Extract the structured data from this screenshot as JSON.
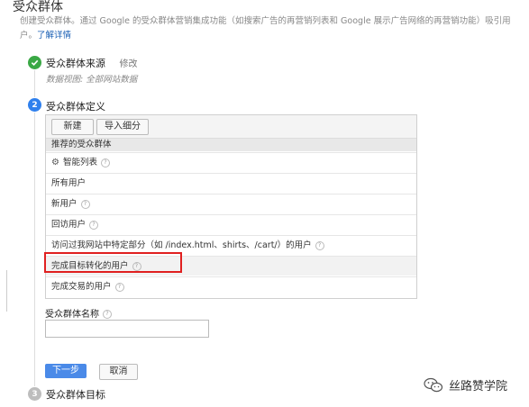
{
  "page_title": "受众群体",
  "description": "创建受众群体。通过 Google 的受众群体营销集成功能（如搜索广告的再营销列表和 Google 展示广告网络的再营销功能）吸引用户。",
  "learn_more": "了解详情",
  "step1": {
    "title": "受众群体来源",
    "edit": "修改",
    "note": "数据视图: 全部网站数据"
  },
  "step2": {
    "number": "2",
    "title": "受众群体定义"
  },
  "toolbar": {
    "new_label": "新建",
    "import_label": "导入细分"
  },
  "recommended_header": "推荐的受众群体",
  "audiences": [
    {
      "label": "智能列表"
    },
    {
      "label": "所有用户"
    },
    {
      "label": "新用户"
    },
    {
      "label": "回访用户"
    },
    {
      "label": "访问过我网站中特定部分（如 /index.html、shirts、/cart/）的用户"
    },
    {
      "label": "完成目标转化的用户"
    },
    {
      "label": "完成交易的用户"
    }
  ],
  "name_field": {
    "label": "受众群体名称",
    "value": "",
    "placeholder": ""
  },
  "buttons": {
    "next": "下一步",
    "cancel": "取消"
  },
  "step3": {
    "number": "3",
    "title": "受众群体目标"
  },
  "watermark": "丝路赞学院",
  "colors": {
    "accent": "#2f80ed",
    "success": "#3aa845",
    "highlight": "#e02020"
  }
}
